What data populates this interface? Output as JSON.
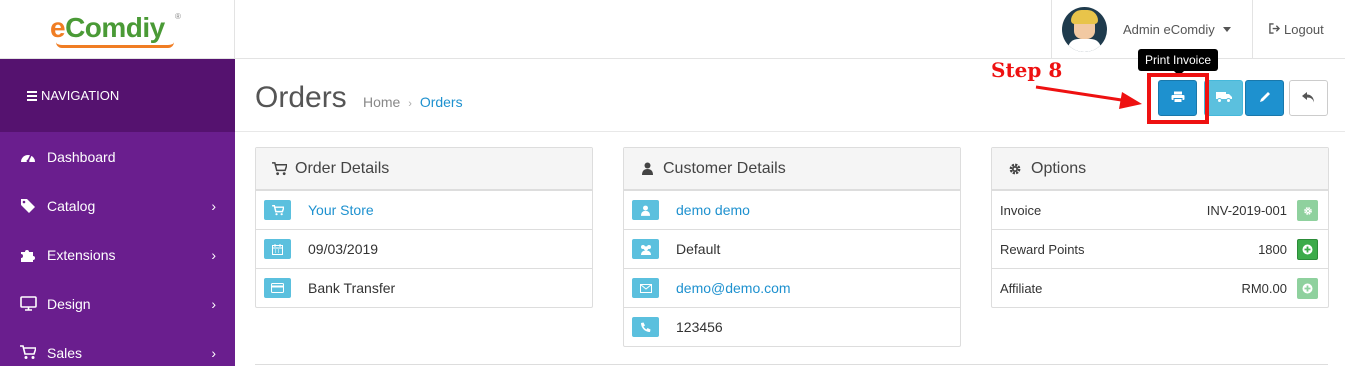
{
  "brand": {
    "logo_e": "e",
    "logo_rest": "Comdiy",
    "reg": "®"
  },
  "header": {
    "username": "Admin eComdiy",
    "logout": "Logout"
  },
  "sidebar": {
    "heading": "NAVIGATION",
    "items": [
      {
        "label": "Dashboard",
        "icon": "dashboard-icon",
        "has_children": false
      },
      {
        "label": "Catalog",
        "icon": "tags-icon",
        "has_children": true
      },
      {
        "label": "Extensions",
        "icon": "puzzle-icon",
        "has_children": true
      },
      {
        "label": "Design",
        "icon": "monitor-icon",
        "has_children": true
      },
      {
        "label": "Sales",
        "icon": "cart-icon",
        "has_children": true
      }
    ]
  },
  "page": {
    "title": "Orders",
    "breadcrumb": [
      "Home",
      "Orders"
    ],
    "tooltip": "Print Invoice",
    "annotation": "Step 8"
  },
  "order_details": {
    "title": "Order Details",
    "rows": [
      {
        "icon": "cart-icon",
        "text": "Your Store",
        "link": true
      },
      {
        "icon": "calendar-icon",
        "text": "09/03/2019",
        "link": false
      },
      {
        "icon": "credit-card-icon",
        "text": "Bank Transfer",
        "link": false
      }
    ]
  },
  "customer_details": {
    "title": "Customer Details",
    "rows": [
      {
        "icon": "user-icon",
        "text": "demo demo",
        "link": true
      },
      {
        "icon": "group-icon",
        "text": "Default",
        "link": false
      },
      {
        "icon": "envelope-icon",
        "text": "demo@demo.com",
        "link": true
      },
      {
        "icon": "phone-icon",
        "text": "123456",
        "link": false
      }
    ]
  },
  "options": {
    "title": "Options",
    "rows": [
      {
        "label": "Invoice",
        "value": "INV-2019-001",
        "button": "cog",
        "enabled": false
      },
      {
        "label": "Reward Points",
        "value": "1800",
        "button": "plus",
        "enabled": true
      },
      {
        "label": "Affiliate",
        "value": "RM0.00",
        "button": "plus",
        "enabled": false
      }
    ]
  },
  "colors": {
    "sidebar": "#6a1e8e",
    "sidebar_head": "#55126f",
    "primary": "#1e91cf",
    "info": "#5bc0de",
    "annotation": "#ee1111"
  }
}
